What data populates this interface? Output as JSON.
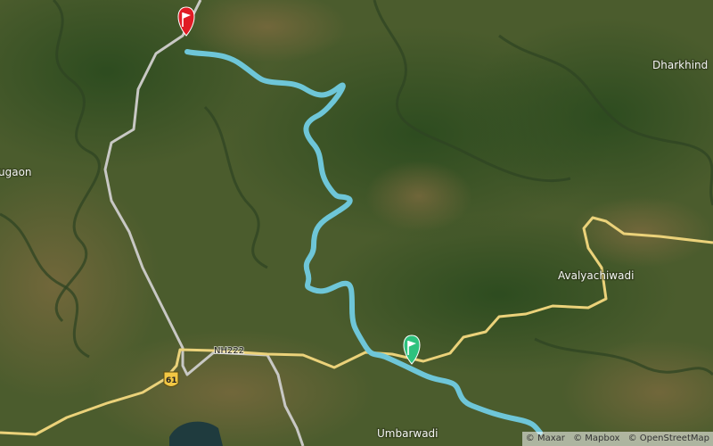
{
  "map": {
    "places": [
      {
        "id": "dharkhind",
        "label": "Dharkhind"
      },
      {
        "id": "ugaon",
        "label": "ugaon"
      },
      {
        "id": "avalyachiwadi",
        "label": "Avalyachiwadi"
      },
      {
        "id": "umbarwadi",
        "label": "Umbarwadi"
      }
    ],
    "roads": {
      "nh_label": "NH222",
      "shield_label": "61"
    },
    "markers": {
      "start": {
        "icon": "flag-icon",
        "color": "#2ec27e"
      },
      "end": {
        "icon": "flag-icon",
        "color": "#e01b24"
      }
    },
    "route_color": "#6ec6d8"
  },
  "attribution": {
    "maxar": "© Maxar",
    "mapbox": "© Mapbox",
    "osm": "© OpenStreetMap"
  }
}
